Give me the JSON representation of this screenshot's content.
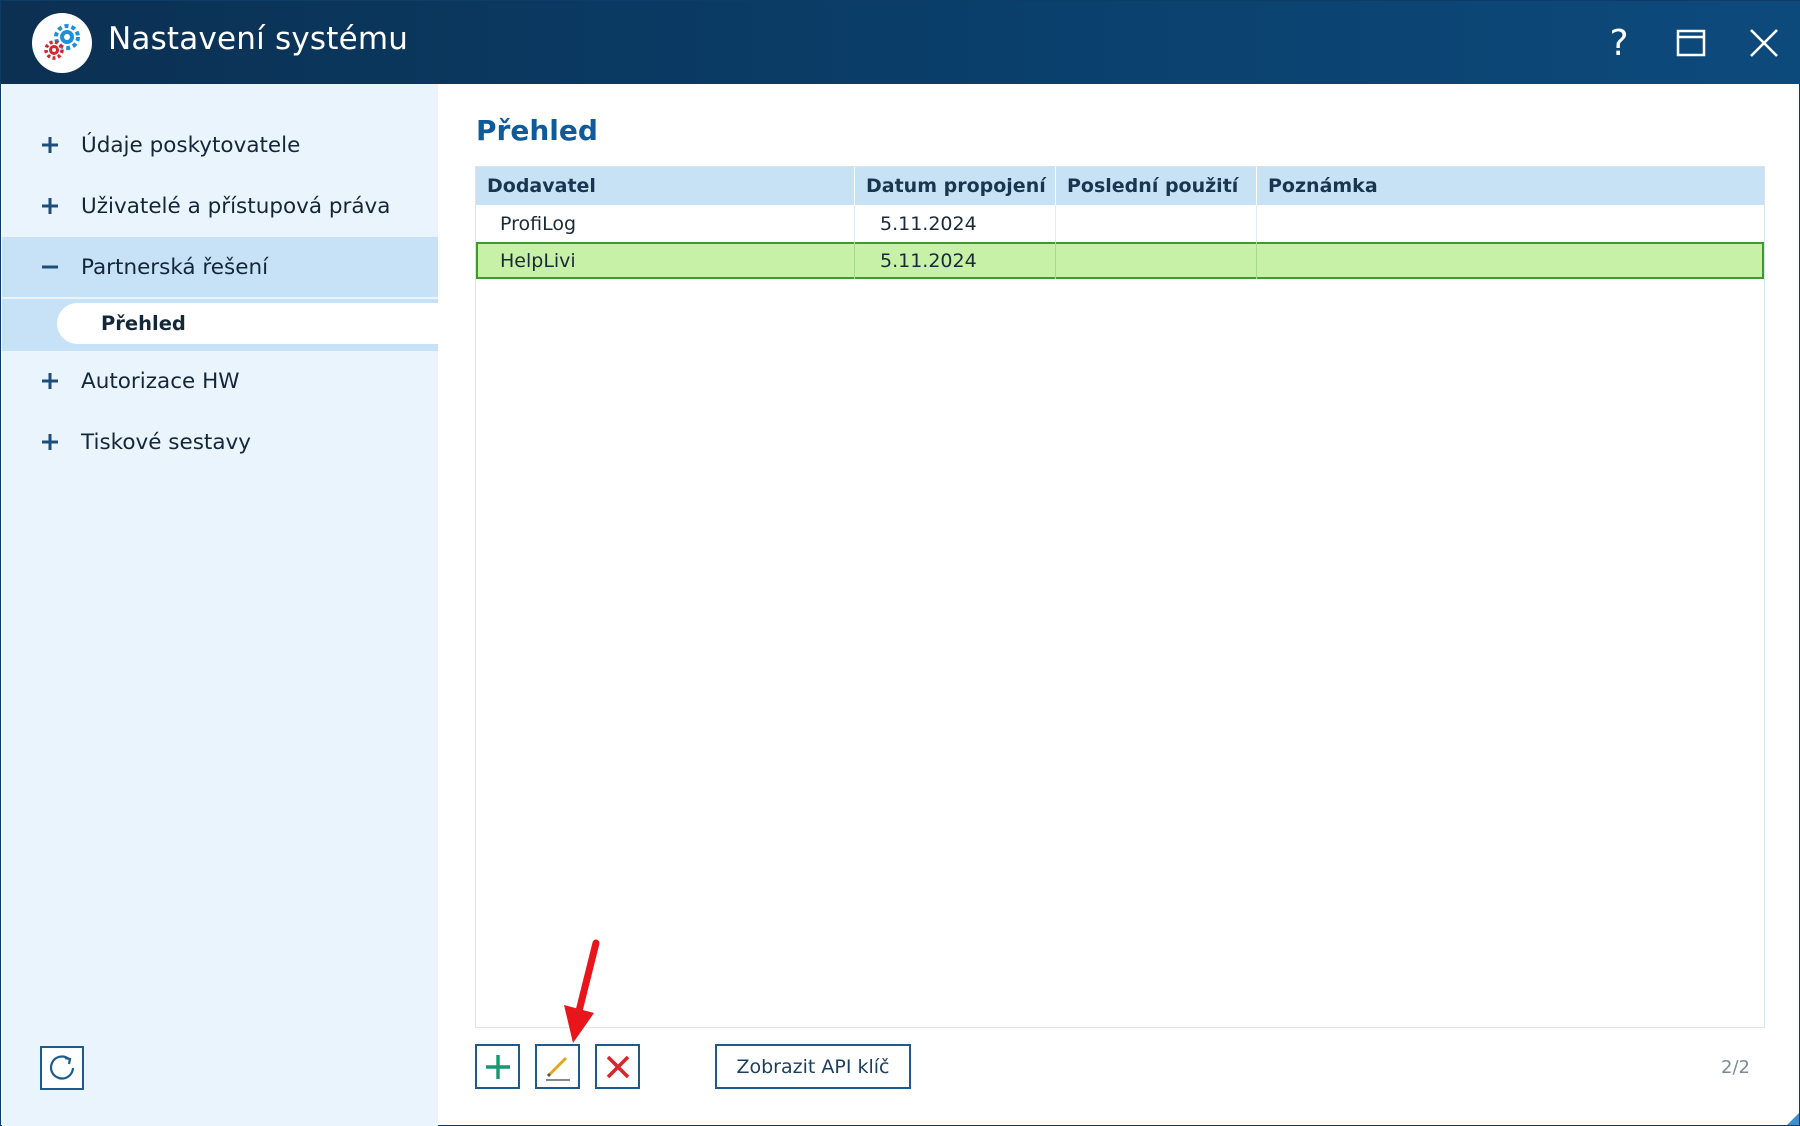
{
  "window": {
    "title": "Nastavení systému",
    "help_label": "?"
  },
  "sidebar": {
    "items": [
      {
        "sign": "+",
        "label": "Údaje poskytovatele"
      },
      {
        "sign": "+",
        "label": "Uživatelé a přístupová práva"
      },
      {
        "sign": "−",
        "label": "Partnerská řešení"
      },
      {
        "sign": "+",
        "label": "Autorizace HW"
      },
      {
        "sign": "+",
        "label": "Tiskové sestavy"
      }
    ],
    "subitem": {
      "label": "Přehled"
    }
  },
  "main": {
    "title": "Přehled",
    "table": {
      "columns": [
        "Dodavatel",
        "Datum propojení",
        "Poslední použití",
        "Poznámka"
      ],
      "rows": [
        {
          "supplier": "ProfiLog",
          "date": "5.11.2024",
          "last_used": "",
          "note": ""
        },
        {
          "supplier": "HelpLivi",
          "date": "5.11.2024",
          "last_used": "",
          "note": "",
          "selected": true
        }
      ]
    },
    "toolbar": {
      "api_key_label": "Zobrazit API klíč",
      "page_count": "2/2"
    }
  },
  "colors": {
    "titlebar": "#0b3052",
    "accent": "#0f5a9a",
    "sidebar_bg": "#eaf4fc",
    "selected_row": "#c7f1a6",
    "add_icon": "#149a6e",
    "delete_icon": "#d9262b",
    "annotation_arrow": "#e8161b"
  },
  "icons": [
    "app-gears-icon",
    "help-icon",
    "maximize-icon",
    "close-icon",
    "plus-icon",
    "minus-icon",
    "refresh-icon",
    "add-icon",
    "edit-icon",
    "delete-icon",
    "annotation-arrow-icon"
  ]
}
